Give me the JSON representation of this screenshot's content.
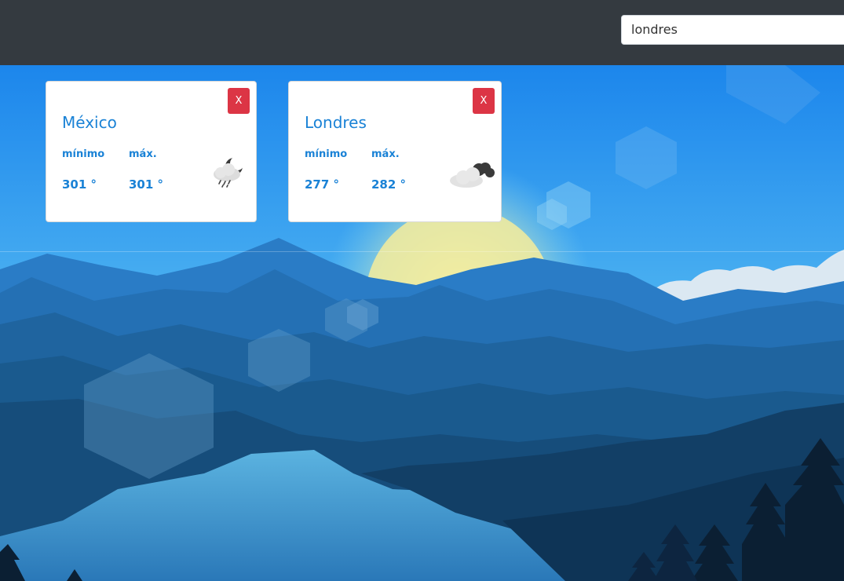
{
  "search": {
    "value": "londres"
  },
  "cards": [
    {
      "city": "México",
      "close_label": "X",
      "min_label": "mínimo",
      "max_label": "máx.",
      "min_value": "301 °",
      "max_value": "301 °",
      "icon": "rain-cloud-moon-icon"
    },
    {
      "city": "Londres",
      "close_label": "X",
      "min_label": "mínimo",
      "max_label": "máx.",
      "min_value": "277 °",
      "max_value": "282 °",
      "icon": "cloudy-night-icon"
    }
  ],
  "colors": {
    "navbar": "#343a40",
    "accent": "#1a82d6",
    "close_button": "#dc3545"
  }
}
